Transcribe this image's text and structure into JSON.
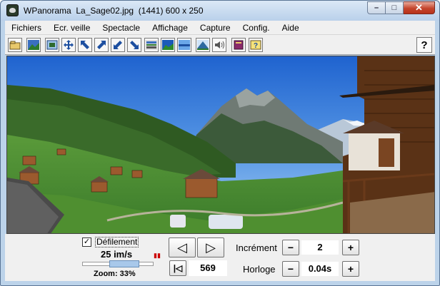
{
  "window": {
    "title": "WPanorama  La_Sage02.jpg  (1441) 600 x 250",
    "controls": {
      "minimize": "–",
      "maximize": "□",
      "close": "✕"
    }
  },
  "menu": {
    "items": [
      "Fichiers",
      "Ecr. veille",
      "Spectacle",
      "Affichage",
      "Capture",
      "Config.",
      "Aide"
    ]
  },
  "toolbar": {
    "icons": [
      "open-folder-icon",
      "image-icon",
      "fit-window-icon",
      "move-arrows-icon",
      "arrow-upleft-icon",
      "arrow-upright-icon",
      "arrow-downleft-icon",
      "arrow-downright-icon",
      "panorama-strip-icon",
      "panorama-view-icon",
      "panorama-wide-icon",
      "landscape-icon",
      "sound-icon",
      "book-icon",
      "help-document-icon"
    ],
    "help_label": "?"
  },
  "controls": {
    "scroll_label": "Défilement",
    "scroll_checked": true,
    "speed": "25 im/s",
    "zoom_label": "Zoom: 33%",
    "zoom_fraction": 0.33,
    "position_value": "569",
    "increment_label": "Incrément",
    "increment_value": "2",
    "clock_label": "Horloge",
    "clock_value": "0.04s",
    "minus": "−",
    "plus": "+",
    "prev_glyph": "◁",
    "next_glyph": "▷",
    "start_glyph": "|◁"
  }
}
